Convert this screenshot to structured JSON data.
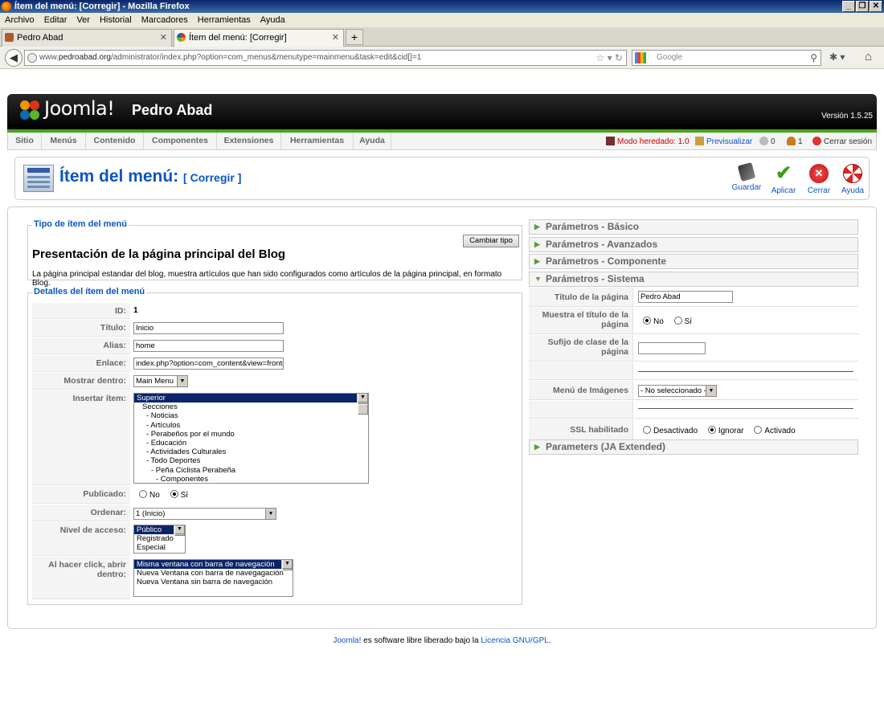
{
  "browser": {
    "window_title": "Ítem del menú: [Corregir] - Mozilla Firefox",
    "window_buttons": [
      "_",
      "❐",
      "✕"
    ],
    "menu": [
      "Archivo",
      "Editar",
      "Ver",
      "Historial",
      "Marcadores",
      "Herramientas",
      "Ayuda"
    ],
    "tabs": [
      {
        "label": "Pedro Abad",
        "close": "✕"
      },
      {
        "label": "Ítem del menú: [Corregir]",
        "close": "✕"
      }
    ],
    "newtab": "+",
    "url_host": "www.pedroabad.org",
    "url_prefix": "www.",
    "url_domain": "pedroabad.org",
    "url_path": "/administrator/index.php?option=com_menus&menutype=mainmenu&task=edit&cid[]=1",
    "search_placeholder": "Google"
  },
  "joomla": {
    "logo_text": "Joomla!",
    "site_name": "Pedro Abad",
    "version": "Versión 1.5.25",
    "menu": [
      "Sitio",
      "Menús",
      "Contenido",
      "Componentes",
      "Extensiones",
      "Herramientas",
      "Ayuda"
    ],
    "status": {
      "legacy": "Modo heredado: 1.0",
      "preview": "Previsualizar",
      "messages": "0",
      "users": "1",
      "logout": "Cerrar sesión"
    },
    "page_title": "Ítem del menú:",
    "page_subtitle": "[ Corregir ]",
    "toolbar": {
      "save": "Guardar",
      "apply": "Aplicar",
      "close": "Cerrar",
      "help": "Ayuda"
    }
  },
  "type_section": {
    "legend": "Tipo de ítem del menú",
    "change_button": "Cambiar tipo",
    "heading": "Presentación de la página principal del Blog",
    "description": "La página principal estandar del blog, muestra artículos que han sido configurados como artículos de la página principal, en formato Blog."
  },
  "details": {
    "legend": "Detalles del ítem del menú",
    "id_label": "ID:",
    "id_value": "1",
    "title_label": "Título:",
    "title_value": "Inicio",
    "alias_label": "Alias:",
    "alias_value": "home",
    "link_label": "Enlace:",
    "link_value": "index.php?option=com_content&view=frontpa",
    "show_in_label": "Mostrar dentro:",
    "show_in_value": "Main Menu",
    "insert_label": "Insertar ítem:",
    "insert_items": [
      "Superior",
      "Secciones",
      "- Noticias",
      "- Artículos",
      "- Perabeños por el mundo",
      "- Educación",
      "- Actividades Culturales",
      "- Todo Deportes",
      "- Peña Ciclista Perabeña",
      "- Componentes"
    ],
    "published_label": "Publicado:",
    "published_no": "No",
    "published_yes": "Sí",
    "order_label": "Ordenar:",
    "order_value": "1 (Inicio)",
    "access_label": "Nivel de acceso:",
    "access_items": [
      "Público",
      "Registrado",
      "Especial"
    ],
    "open_label": "Al hacer click, abrir dentro:",
    "open_items": [
      "Misma ventana con barra de navegación",
      "Nueva Ventana con barra de navegagación",
      "Nueva Ventana sin barra de navegación"
    ]
  },
  "params": {
    "basic": "Parámetros - Básico",
    "advanced": "Parámetros - Avanzados",
    "component": "Parámetros - Componente",
    "system": "Parámetros - Sistema",
    "extended": "Parameters (JA Extended)",
    "page_title_label": "Título de la página",
    "page_title_value": "Pedro Abad",
    "show_title_label": "Muestra el título de la página",
    "show_title_no": "No",
    "show_title_yes": "Sí",
    "suffix_label": "Sufijo de clase de la página",
    "image_menu_label": "Menú de Imágenes",
    "image_menu_value": "- No seleccionado -",
    "ssl_label": "SSL habilitado",
    "ssl_off": "Desactivado",
    "ssl_ignore": "Ignorar",
    "ssl_on": "Activado"
  },
  "footer": {
    "joomla_link": "Joomla!",
    "text": " es software libre liberado bajo la ",
    "license_link": "Licencia GNU/GPL",
    "end": "."
  }
}
